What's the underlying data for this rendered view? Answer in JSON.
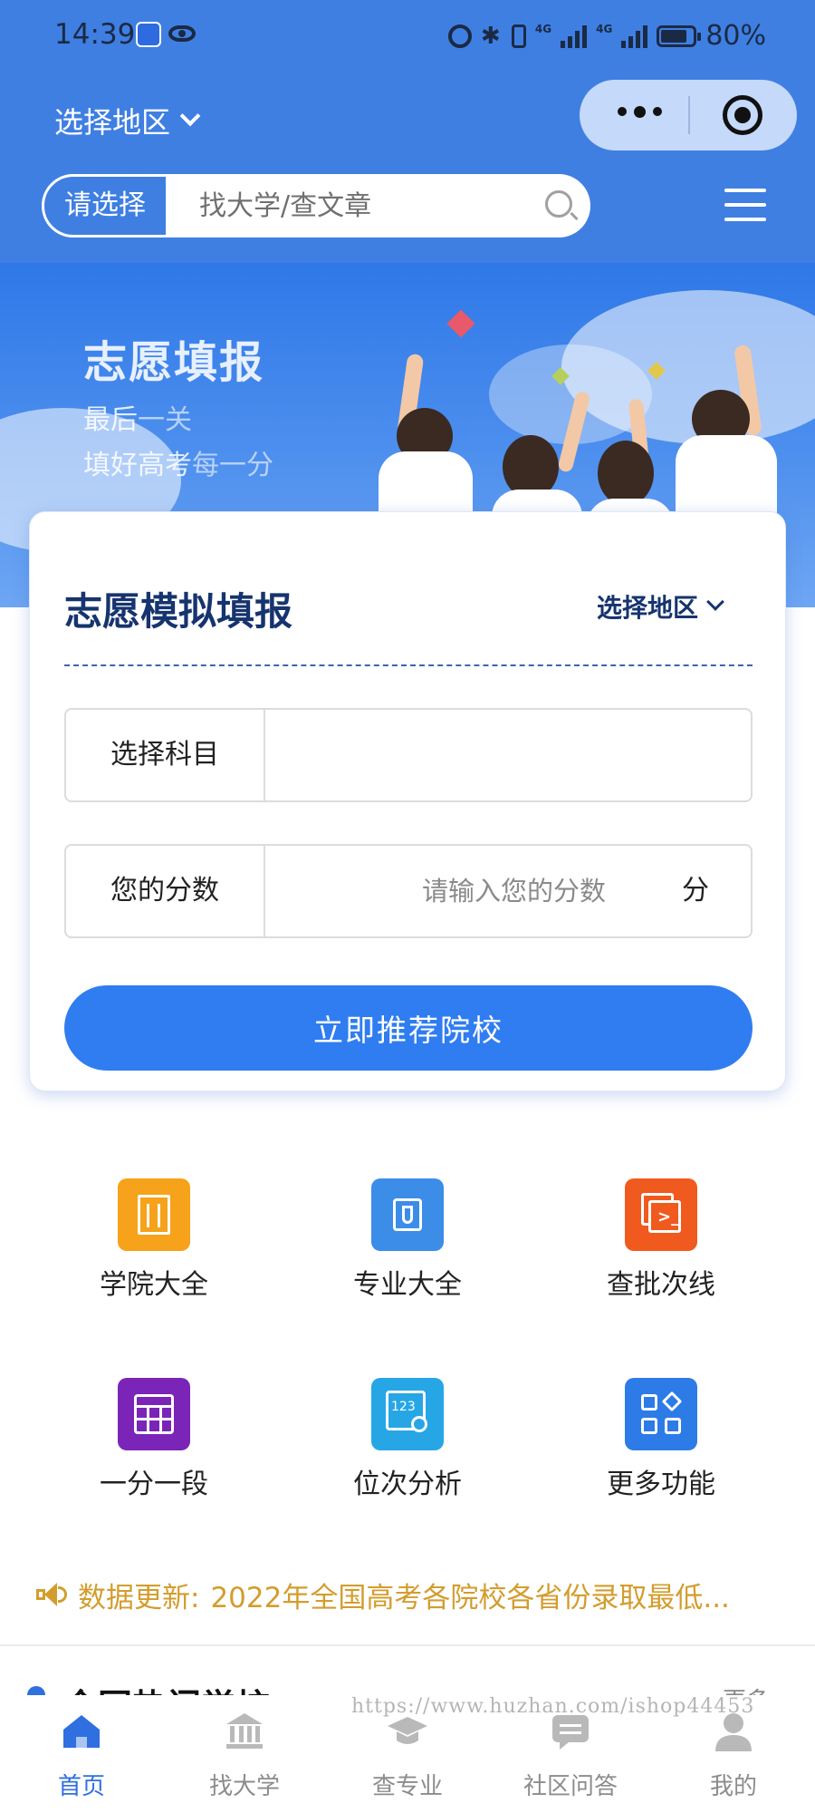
{
  "status_bar": {
    "time": "14:39",
    "battery": "80%",
    "network_labels": [
      "4G",
      "4G"
    ]
  },
  "header": {
    "region_label": "选择地区",
    "search": {
      "select_label": "请选择",
      "placeholder": "找大学/查文章"
    }
  },
  "banner": {
    "title": "志愿填报",
    "line1_a": "最后",
    "line1_b": "一关",
    "line2_a": "填好高考",
    "line2_b": "每一分"
  },
  "form": {
    "title": "志愿模拟填报",
    "region_label": "选择地区",
    "subject_label": "选择科目",
    "score_label": "您的分数",
    "score_placeholder": "请输入您的分数",
    "score_unit": "分",
    "submit_label": "立即推荐院校"
  },
  "features": [
    {
      "label": "学院大全",
      "icon": "building-icon",
      "color": "#f6a21a"
    },
    {
      "label": "专业大全",
      "icon": "tie-icon",
      "color": "#3b8de8"
    },
    {
      "label": "查批次线",
      "icon": "terminal-icon",
      "color": "#f05a1e"
    },
    {
      "label": "一分一段",
      "icon": "calendar-grid-icon",
      "color": "#7b25b8"
    },
    {
      "label": "位次分析",
      "icon": "rank-search-icon",
      "color": "#27a6e6"
    },
    {
      "label": "更多功能",
      "icon": "apps-grid-icon",
      "color": "#2d7be6"
    }
  ],
  "notice": {
    "prefix": "数据更新:",
    "text": "2022年全国高考各院校各省份录取最低..."
  },
  "section": {
    "title": "全国热门学校",
    "more": "更多"
  },
  "bottom_nav": [
    {
      "label": "首页",
      "icon": "home-icon",
      "active": true
    },
    {
      "label": "找大学",
      "icon": "university-icon",
      "active": false
    },
    {
      "label": "查专业",
      "icon": "graduation-cap-icon",
      "active": false
    },
    {
      "label": "社区问答",
      "icon": "chat-bubble-icon",
      "active": false
    },
    {
      "label": "我的",
      "icon": "user-icon",
      "active": false
    }
  ],
  "watermark": "https://www.huzhan.com/ishop44453",
  "colors": {
    "brand_blue": "#3f7fe2",
    "button_blue": "#2f7df0",
    "title_navy": "#16346e",
    "notice_gold": "#d39d2e"
  }
}
